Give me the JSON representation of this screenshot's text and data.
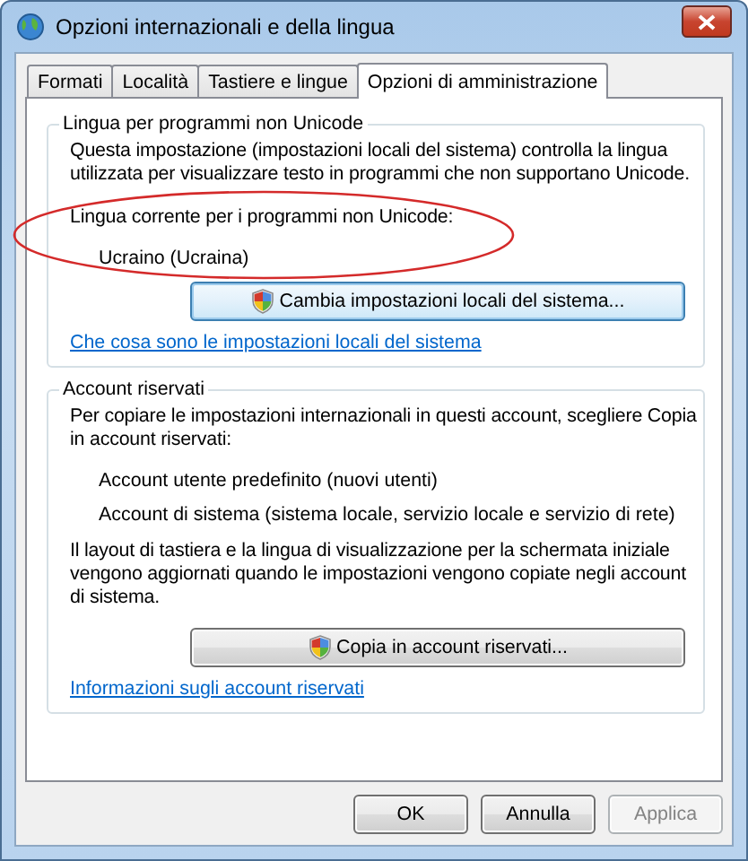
{
  "window": {
    "title": "Opzioni internazionali e della lingua"
  },
  "tabs": [
    {
      "label": "Formati",
      "selected": false
    },
    {
      "label": "Località",
      "selected": false
    },
    {
      "label": "Tastiere e lingue",
      "selected": false
    },
    {
      "label": "Opzioni di amministrazione",
      "selected": true
    }
  ],
  "groups": [
    {
      "title": "Lingua per programmi non Unicode",
      "annotation": {
        "kind": "ellipse",
        "color": "#d42a2a"
      },
      "items": [
        {
          "kind": "text",
          "text": "Questa impostazione (impostazioni locali del sistema) controlla la lingua utilizzata per visualizzare testo in programmi che non supportano Unicode."
        },
        {
          "kind": "text",
          "text": "Lingua corrente per i programmi non Unicode:"
        },
        {
          "kind": "value",
          "text": "Ucraino (Ucraina)"
        },
        {
          "kind": "button",
          "text": "Cambia impostazioni locali del sistema...",
          "focused": true
        },
        {
          "kind": "link",
          "text": "Che cosa sono le impostazioni locali del sistema"
        }
      ]
    },
    {
      "title": "Account riservati",
      "items": [
        {
          "kind": "text",
          "text": "Per copiare le impostazioni internazionali in questi account, scegliere Copia in account riservati:"
        },
        {
          "kind": "value",
          "text": "Account utente predefinito (nuovi utenti)"
        },
        {
          "kind": "value",
          "text": "Account di sistema (sistema locale, servizio locale e servizio di rete)"
        },
        {
          "kind": "text",
          "text": "Il layout di tastiera e la lingua di visualizzazione per la schermata iniziale vengono aggiornati quando le impostazioni vengono copiate negli account di sistema."
        },
        {
          "kind": "button",
          "text": "Copia in account riservati...",
          "focused": false
        },
        {
          "kind": "link",
          "text": "Informazioni sugli account riservati"
        }
      ]
    }
  ],
  "buttons": [
    {
      "label": "OK",
      "disabled": false
    },
    {
      "label": "Annulla",
      "disabled": false
    },
    {
      "label": "Applica",
      "disabled": true
    }
  ]
}
